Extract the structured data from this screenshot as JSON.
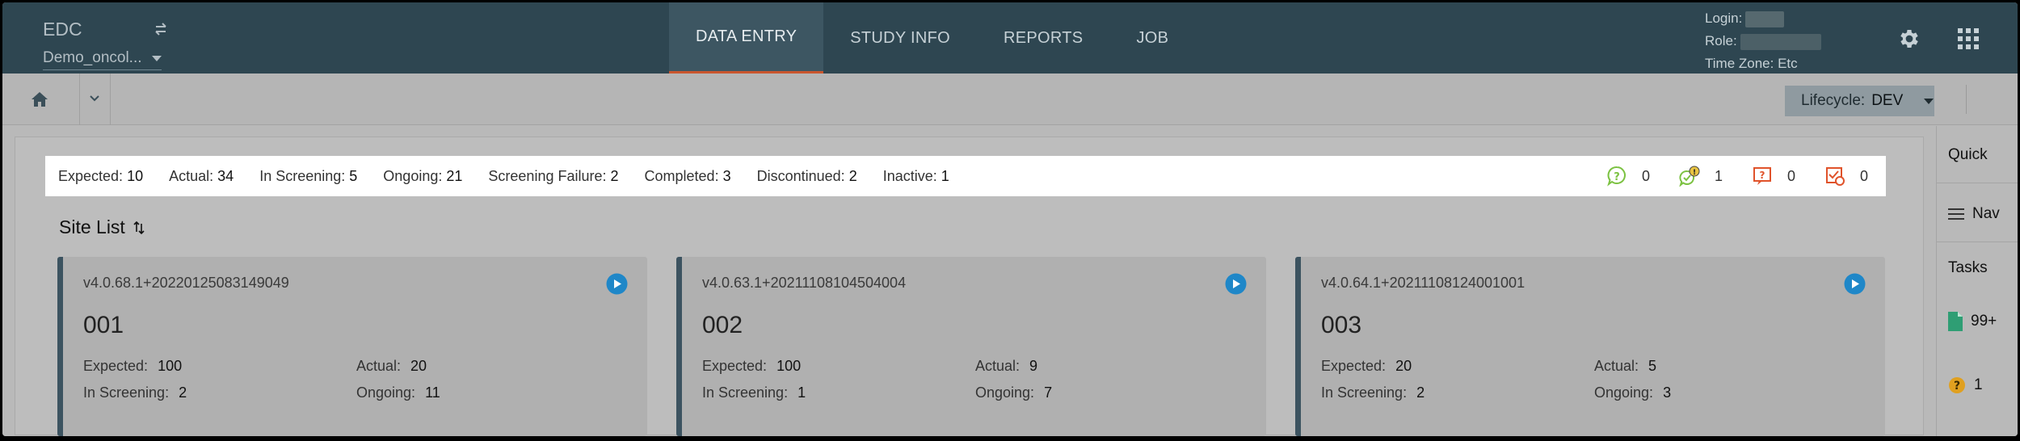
{
  "header": {
    "app_name": "EDC",
    "study": "Demo_oncol...",
    "tabs": [
      {
        "label": "DATA ENTRY",
        "active": true
      },
      {
        "label": "STUDY INFO",
        "active": false
      },
      {
        "label": "REPORTS",
        "active": false
      },
      {
        "label": "JOB",
        "active": false
      }
    ],
    "user": {
      "login_label": "Login:",
      "role_label": "Role:",
      "timezone": "Time Zone: Etc"
    }
  },
  "toolbar": {
    "lifecycle_label": "Lifecycle:",
    "lifecycle_value": "DEV"
  },
  "summary": {
    "items": [
      {
        "label": "Expected:",
        "value": "10"
      },
      {
        "label": "Actual:",
        "value": "34"
      },
      {
        "label": "In Screening:",
        "value": "5"
      },
      {
        "label": "Ongoing:",
        "value": "21"
      },
      {
        "label": "Screening Failure:",
        "value": "2"
      },
      {
        "label": "Completed:",
        "value": "3"
      },
      {
        "label": "Discontinued:",
        "value": "2"
      },
      {
        "label": "Inactive:",
        "value": "1"
      }
    ],
    "queries": [
      {
        "icon": "open-query-icon",
        "count": "0",
        "color": "#7cc242"
      },
      {
        "icon": "answered-query-icon",
        "count": "1",
        "color": "#7cc242"
      },
      {
        "icon": "closed-query-icon",
        "count": "0",
        "color": "#e0532b"
      },
      {
        "icon": "cancelled-query-icon",
        "count": "0",
        "color": "#e0532b"
      }
    ]
  },
  "site_list": {
    "title": "Site List",
    "sites": [
      {
        "version": "v4.0.68.1+20220125083149049",
        "code": "001",
        "expected": "100",
        "actual": "20",
        "in_screening": "2",
        "ongoing": "11"
      },
      {
        "version": "v4.0.63.1+20211108104504004",
        "code": "002",
        "expected": "100",
        "actual": "9",
        "in_screening": "1",
        "ongoing": "7"
      },
      {
        "version": "v4.0.64.1+20211108124001001",
        "code": "003",
        "expected": "20",
        "actual": "5",
        "in_screening": "2",
        "ongoing": "3"
      }
    ],
    "labels": {
      "expected": "Expected:",
      "actual": "Actual:",
      "in_screening": "In Screening:",
      "ongoing": "Ongoing:"
    }
  },
  "quick_panel": {
    "quick": "Quick",
    "nav": "Nav",
    "tasks": "Tasks",
    "doc_count": "99+",
    "help_count": "1"
  },
  "colors": {
    "header_bg": "#2e4651",
    "active_tab_underline": "#c9562e",
    "play_button": "#1f87c8",
    "doc_icon": "#2f9e74",
    "help_icon": "#e0a020"
  }
}
